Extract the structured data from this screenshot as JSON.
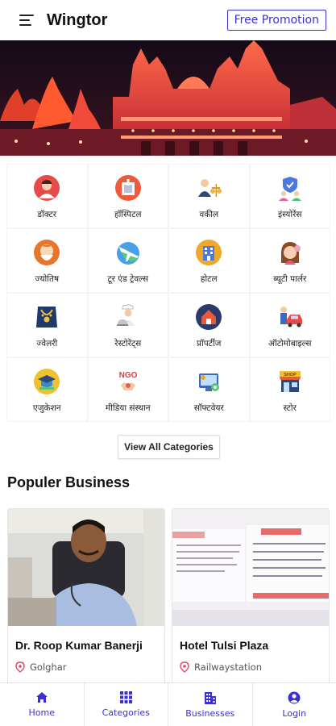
{
  "header": {
    "title": "Wingtor",
    "promo_label": "Free Promotion"
  },
  "colors": {
    "accent": "#3a2fd6",
    "pin": "#e0466e"
  },
  "categories": [
    {
      "label": "डॉक्टर",
      "icon": "doctor-icon"
    },
    {
      "label": "हॉस्पिटल",
      "icon": "hospital-icon"
    },
    {
      "label": "वकील",
      "icon": "lawyer-icon"
    },
    {
      "label": "इंस्योरेंस",
      "icon": "insurance-icon"
    },
    {
      "label": "ज्योतिष",
      "icon": "astrology-icon"
    },
    {
      "label": "टूर एंड ट्रेवल्स",
      "icon": "tour-travel-icon"
    },
    {
      "label": "होटल",
      "icon": "hotel-icon"
    },
    {
      "label": "ब्यूटी पार्लर",
      "icon": "beauty-parlour-icon"
    },
    {
      "label": "ज्वेलरी",
      "icon": "jewellery-icon"
    },
    {
      "label": "रेस्टोरेंट्स",
      "icon": "restaurant-icon"
    },
    {
      "label": "प्रॉपर्टीज",
      "icon": "property-icon"
    },
    {
      "label": "ऑटोमोबाइल्स",
      "icon": "automobile-icon"
    },
    {
      "label": "एजुकेशन",
      "icon": "education-icon"
    },
    {
      "label": "मीडिया संस्थान",
      "icon": "ngo-media-icon"
    },
    {
      "label": "सॉफ्टवेयर",
      "icon": "software-icon"
    },
    {
      "label": "स्टोर",
      "icon": "store-icon"
    }
  ],
  "view_all_label": "View All Categories",
  "section_title": "Populer Business",
  "businesses": [
    {
      "name": "Dr. Roop Kumar Banerji",
      "location": "Golghar"
    },
    {
      "name": "Hotel Tulsi Plaza",
      "location": "Railwaystation"
    }
  ],
  "bottom_nav": [
    {
      "label": "Home",
      "icon": "home-icon"
    },
    {
      "label": "Categories",
      "icon": "grid-icon"
    },
    {
      "label": "Businesses",
      "icon": "building-icon"
    },
    {
      "label": "Login",
      "icon": "user-icon"
    }
  ]
}
